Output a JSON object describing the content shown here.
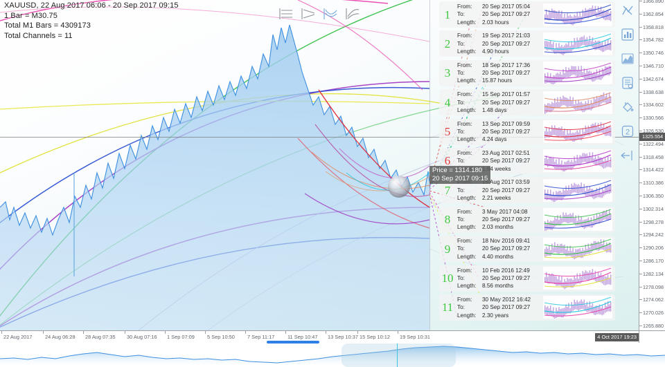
{
  "chart_header": {
    "title": "XAUUSD, 22 Aug 2017 06:06 - 20 Sep 2017 09:15",
    "bar_line": "1 Bar = M30.75",
    "total_bars_line": "Total M1 Bars = 4309173",
    "total_channels_line": "Total Channels = 11"
  },
  "tooltip": {
    "price_line": "Price = 1314.180",
    "time_line": "20 Sep 2017 09:15"
  },
  "legend_glyphs": [
    {
      "name": "parallel-channel-icon",
      "color": "#8e9296"
    },
    {
      "name": "converging-channel-icon",
      "color": "#8e9296"
    },
    {
      "name": "curved-up-channel-icon",
      "color": "#6fa8dc"
    },
    {
      "name": "curved-channel-icon",
      "color": "#8e9296"
    }
  ],
  "toolbar": [
    {
      "name": "crossed-indicator-icon",
      "label": "Indicators"
    },
    {
      "name": "bar-chart-icon",
      "label": "Bar chart"
    },
    {
      "name": "area-chart-icon",
      "label": "Area chart"
    },
    {
      "name": "list-settings-icon",
      "label": "List"
    },
    {
      "name": "paint-bucket-icon",
      "label": "Fill color"
    },
    {
      "name": "zoom-level-2-icon",
      "label": "2"
    },
    {
      "name": "scroll-back-arrow-icon",
      "label": "Back"
    }
  ],
  "channels": {
    "labels": {
      "from": "From:",
      "to": "To:",
      "length": "Length:"
    },
    "rows": [
      {
        "num": "1",
        "num_color": "#3ec93e",
        "from": "20 Sep 2017 05:04",
        "to": "20 Sep 2017 09:27",
        "length": "2.03 hours",
        "thumb_colors": [
          "#1f3fc0",
          "#2b4fd8"
        ]
      },
      {
        "num": "2",
        "num_color": "#3ec93e",
        "from": "19 Sep 2017 21:03",
        "to": "20 Sep 2017 09:27",
        "length": "4.90 hours",
        "thumb_colors": [
          "#20c8e0",
          "#2440c8"
        ]
      },
      {
        "num": "3",
        "num_color": "#3ec93e",
        "from": "18 Sep 2017 17:36",
        "to": "20 Sep 2017 09:27",
        "length": "15.87 hours",
        "thumb_colors": [
          "#c040c8",
          "#9b30c0"
        ]
      },
      {
        "num": "4",
        "num_color": "#3ec93e",
        "from": "15 Sep 2017 01:57",
        "to": "20 Sep 2017 09:27",
        "length": "1.48 days",
        "thumb_colors": [
          "#e08a60",
          "#d86a80"
        ]
      },
      {
        "num": "5",
        "num_color": "#e03a3a",
        "from": "13 Sep 2017 09:59",
        "to": "20 Sep 2017 09:27",
        "length": "4.24 days",
        "thumb_colors": [
          "#e02838",
          "#f04050"
        ]
      },
      {
        "num": "6",
        "num_color": "#e03a3a",
        "from": "23 Aug 2017 02:51",
        "to": "20 Sep 2017 09:27",
        "length": "1.84 weeks",
        "thumb_colors": [
          "#b030c8",
          "#e040a0"
        ]
      },
      {
        "num": "7",
        "num_color": "#3ec93e",
        "from": "15 Aug 2017 03:59",
        "to": "20 Sep 2017 09:27",
        "length": "2.21 weeks",
        "thumb_colors": [
          "#2448d0",
          "#a038c8"
        ]
      },
      {
        "num": "8",
        "num_color": "#3ec93e",
        "from": "3 May 2017 04:08",
        "to": "20 Sep 2017 09:27",
        "length": "2.03 months",
        "thumb_colors": [
          "#36c048",
          "#2440d0"
        ]
      },
      {
        "num": "9",
        "num_color": "#3ec93e",
        "from": "18 Nov 2016 09:41",
        "to": "20 Sep 2017 09:27",
        "length": "4.40 months",
        "thumb_colors": [
          "#36c048",
          "#e0e030"
        ]
      },
      {
        "num": "10",
        "num_color": "#3ec93e",
        "from": "10 Feb 2016 12:49",
        "to": "20 Sep 2017 09:27",
        "length": "8.56 months",
        "thumb_colors": [
          "#e83ca8",
          "#e0e030"
        ]
      },
      {
        "num": "11",
        "num_color": "#3ec93e",
        "from": "30 May 2012 16:42",
        "to": "20 Sep 2017 09:27",
        "length": "2.30 years",
        "thumb_colors": [
          "#20c8e0",
          "#e83ca8"
        ]
      }
    ]
  },
  "chart_data": {
    "type": "line",
    "title": "XAUUSD, 22 Aug 2017 06:06 - 20 Sep 2017 09:15",
    "symbol": "XAUUSD",
    "xlabel": "",
    "ylabel": "",
    "grid": false,
    "legend_position": "none",
    "ylim": [
      1265.88,
      1366.89
    ],
    "y_ticks": [
      "1366.890",
      "1362.854",
      "1358.818",
      "1354.782",
      "1350.746",
      "1346.710",
      "1342.674",
      "1338.638",
      "1334.602",
      "1330.566",
      "1326.530",
      "1322.494",
      "1318.458",
      "1314.422",
      "1310.386",
      "1306.350",
      "1302.314",
      "1298.278",
      "1294.242",
      "1290.206",
      "1286.170",
      "1282.134",
      "1278.098",
      "1274.062",
      "1270.026",
      "1265.880"
    ],
    "y_current": "1325.554",
    "x_ticks": [
      "22 Aug 2017",
      "24 Aug 06:28",
      "28 Aug 07:35",
      "30 Aug 07:16",
      "1 Sep 07:09",
      "5 Sep 10:50",
      "7 Sep 11:17",
      "11 Sep 10:47",
      "13 Sep 10:37",
      "15 Sep 10:12",
      "19 Sep 10:31"
    ],
    "x_current": "4 Oct 2017 19:23",
    "series": [
      {
        "name": "XAUUSD price",
        "color": "#3d8fe0",
        "fill": "#aed3f2",
        "values": [
          1288.2,
          1289.1,
          1287.4,
          1290.6,
          1288.9,
          1292.3,
          1291.0,
          1294.8,
          1293.2,
          1296.5,
          1295.1,
          1298.4,
          1297.0,
          1300.8,
          1299.3,
          1303.6,
          1302.0,
          1306.2,
          1305.0,
          1308.4,
          1307.1,
          1310.5,
          1309.2,
          1312.8,
          1311.4,
          1315.0,
          1313.6,
          1317.2,
          1316.0,
          1319.5,
          1318.1,
          1321.8,
          1320.4,
          1324.0,
          1322.6,
          1326.2,
          1325.0,
          1328.6,
          1327.2,
          1330.8,
          1329.4,
          1333.0,
          1331.6,
          1335.2,
          1334.0,
          1337.6,
          1336.2,
          1339.8,
          1338.4,
          1342.0,
          1340.6,
          1344.2,
          1343.0,
          1346.6,
          1345.2,
          1348.8,
          1347.4,
          1351.0,
          1349.6,
          1353.2,
          1352.0,
          1355.6,
          1354.2,
          1357.8,
          1356.4,
          1360.0,
          1358.6,
          1361.2,
          1359.8,
          1357.4,
          1355.0,
          1352.6,
          1350.2,
          1347.8,
          1345.4,
          1343.0,
          1340.6,
          1338.2,
          1335.8,
          1333.4,
          1331.0,
          1328.6,
          1326.2,
          1323.8,
          1321.4,
          1319.0,
          1316.6,
          1314.2,
          1313.0,
          1314.18
        ]
      }
    ],
    "annotations": [
      {
        "type": "hline",
        "value": 1325.554,
        "color": "#7b7b7b"
      },
      {
        "type": "vline",
        "label": "20 Sep 2017 09:15",
        "color": "#7882a0"
      },
      {
        "type": "point",
        "label": "Price = 1314.180",
        "value": 1314.18
      }
    ],
    "channel_curves": [
      {
        "name": "channel-1",
        "color": "#1f3fc0"
      },
      {
        "name": "channel-2",
        "color": "#20c8e0"
      },
      {
        "name": "channel-3",
        "color": "#c040c8"
      },
      {
        "name": "channel-4",
        "color": "#e08a60"
      },
      {
        "name": "channel-5",
        "color": "#e02838"
      },
      {
        "name": "channel-6",
        "color": "#b030c8"
      },
      {
        "name": "channel-7",
        "color": "#2448d0"
      },
      {
        "name": "channel-8",
        "color": "#36c048"
      },
      {
        "name": "channel-9",
        "color": "#e0e030"
      },
      {
        "name": "channel-10",
        "color": "#e83ca8"
      },
      {
        "name": "channel-11",
        "color": "#20c8e0"
      }
    ]
  },
  "navigator": {
    "name": "overview-navigator",
    "selection_label": ""
  }
}
